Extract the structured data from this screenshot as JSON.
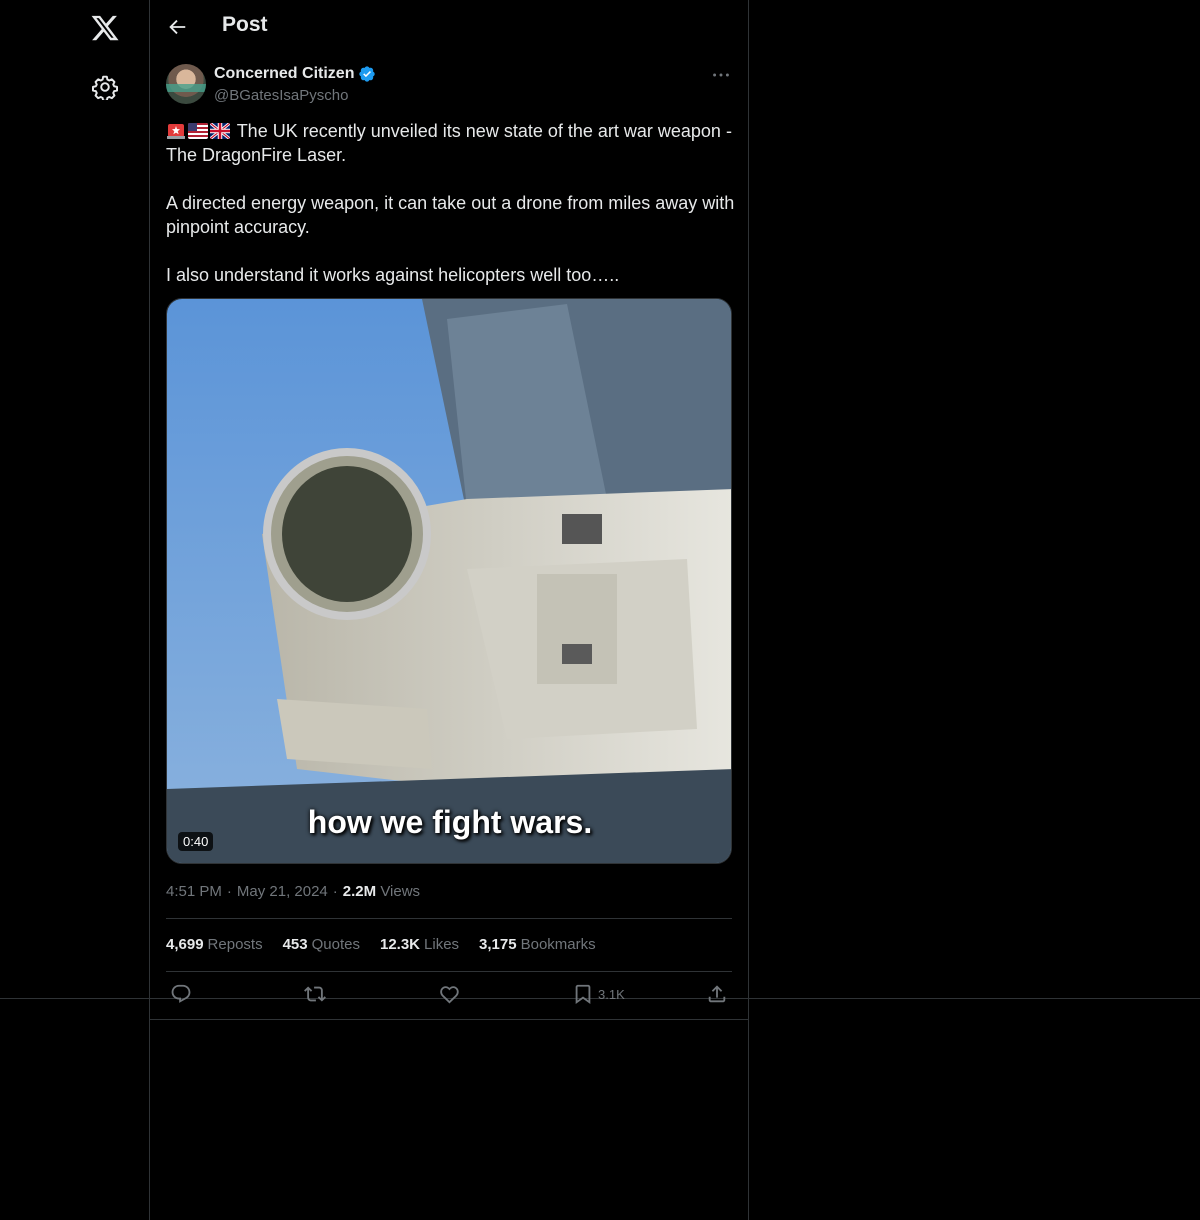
{
  "header": {
    "title": "Post"
  },
  "author": {
    "name": "Concerned Citizen",
    "handle": "@BGatesIsaPyscho"
  },
  "tweet": {
    "line1": "The UK recently unveiled its new state of the art war weapon - The DragonFire Laser.",
    "line2": "A directed energy weapon, it can take out a drone from miles away with pinpoint accuracy.",
    "line3": "I also understand it works against helicopters well too….."
  },
  "media": {
    "duration": "0:40",
    "caption": "how we fight wars."
  },
  "meta": {
    "time": "4:51 PM",
    "date": "May 21, 2024",
    "views_count": "2.2M",
    "views_label": "Views",
    "sep": "·"
  },
  "stats": {
    "reposts_count": "4,699",
    "reposts_label": "Reposts",
    "quotes_count": "453",
    "quotes_label": "Quotes",
    "likes_count": "12.3K",
    "likes_label": "Likes",
    "bookmarks_count": "3,175",
    "bookmarks_label": "Bookmarks"
  },
  "actions": {
    "bookmark_count": "3.1K"
  },
  "colors": {
    "background": "#000000",
    "text": "#e7e9ea",
    "secondary": "#71767b",
    "border": "#2f3336",
    "verified": "#1d9bf0"
  },
  "icons": [
    "x-logo-icon",
    "settings-icon",
    "back-arrow-icon",
    "verified-icon",
    "more-icon",
    "siren-emoji-icon",
    "us-flag-icon",
    "uk-flag-icon",
    "reply-icon",
    "repost-icon",
    "like-icon",
    "bookmark-icon",
    "share-icon"
  ]
}
